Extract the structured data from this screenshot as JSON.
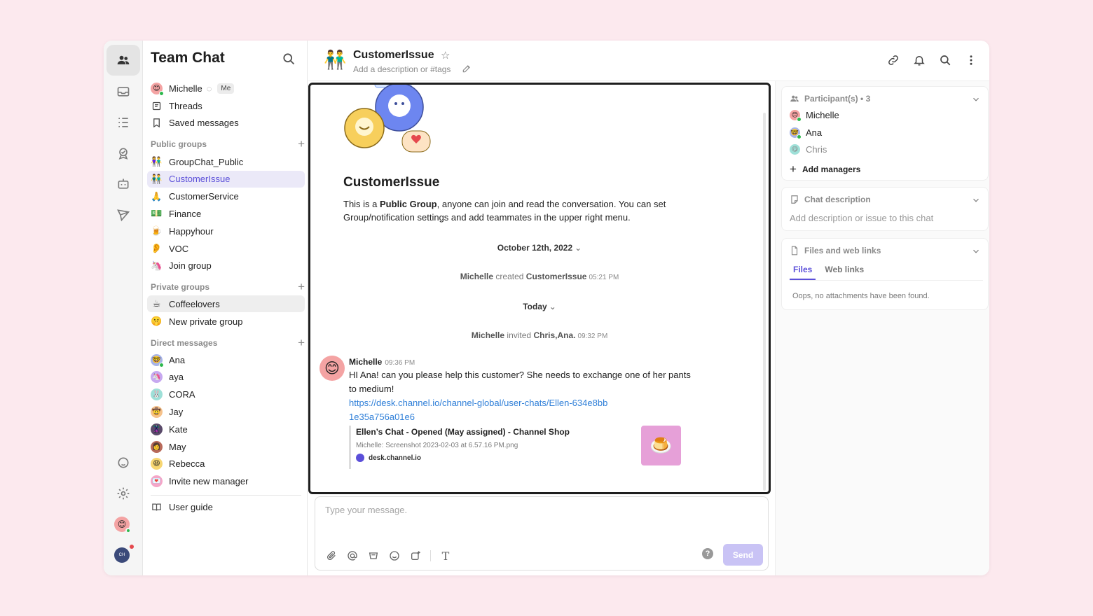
{
  "app": {
    "title": "Team Chat"
  },
  "rail": {
    "items": [
      {
        "name": "team-chat-icon",
        "active": true
      },
      {
        "name": "inbox-icon",
        "active": false
      },
      {
        "name": "list-icon",
        "active": false
      },
      {
        "name": "badge-check-icon",
        "active": false
      },
      {
        "name": "bot-icon",
        "active": false
      },
      {
        "name": "send-icon",
        "active": false
      }
    ],
    "bottom": [
      "support-icon",
      "gear-icon",
      "user-avatar",
      "workspace-avatar"
    ]
  },
  "sidebar": {
    "me": {
      "name": "Michelle",
      "badge": "Me"
    },
    "top_items": [
      {
        "label": "Threads",
        "icon": "threads-icon"
      },
      {
        "label": "Saved messages",
        "icon": "bookmark-icon"
      }
    ],
    "public_groups": {
      "title": "Public groups",
      "items": [
        {
          "label": "GroupChat_Public",
          "emoji": "👫",
          "active": false
        },
        {
          "label": "CustomerIssue",
          "emoji": "👬",
          "active": true
        },
        {
          "label": "CustomerService",
          "emoji": "🙏",
          "active": false
        },
        {
          "label": "Finance",
          "emoji": "💵",
          "active": false
        },
        {
          "label": "Happyhour",
          "emoji": "🍺",
          "active": false
        },
        {
          "label": "VOC",
          "emoji": "👂",
          "active": false
        },
        {
          "label": "Join group",
          "emoji": "🦄",
          "active": false
        }
      ]
    },
    "private_groups": {
      "title": "Private groups",
      "items": [
        {
          "label": "Coffeelovers",
          "emoji": "☕",
          "hover": true
        },
        {
          "label": "New private group",
          "emoji": "🤫",
          "hover": false
        }
      ]
    },
    "direct_messages": {
      "title": "Direct messages",
      "items": [
        {
          "label": "Ana",
          "emoji": "🤓",
          "bg": "#a7b4e8",
          "online": true
        },
        {
          "label": "aya",
          "emoji": "🦄",
          "bg": "#c7a9f0",
          "online": false
        },
        {
          "label": "CORA",
          "emoji": "🐰",
          "bg": "#9ee0d8",
          "online": false
        },
        {
          "label": "Jay",
          "emoji": "🤠",
          "bg": "#f6c28b",
          "online": false
        },
        {
          "label": "Kate",
          "emoji": "🦹",
          "bg": "#5a4a6a",
          "online": false
        },
        {
          "label": "May",
          "emoji": "👩",
          "bg": "#b86a5a",
          "online": false
        },
        {
          "label": "Rebecca",
          "emoji": "😆",
          "bg": "#f7d672",
          "online": false
        },
        {
          "label": "Invite new manager",
          "emoji": "💌",
          "bg": "#f5a6c8",
          "online": false
        }
      ]
    },
    "user_guide": "User guide"
  },
  "header": {
    "title": "CustomerIssue",
    "description_placeholder": "Add a description or #tags"
  },
  "chat": {
    "intro_title": "CustomerIssue",
    "intro_text_1": "This is a ",
    "intro_text_bold": "Public Group",
    "intro_text_2": ", anyone can join and read the conversation. You can set Group/notification settings and add teammates in the upper right menu.",
    "date_1": "October 12th, 2022",
    "sys_1": {
      "actor": "Michelle",
      "verb": "created",
      "target": "CustomerIssue",
      "time": "05:21 PM"
    },
    "date_2": "Today",
    "sys_2": {
      "actor": "Michelle",
      "verb": "invited",
      "target": "Chris,Ana.",
      "time": "09:32 PM"
    },
    "message": {
      "author": "Michelle",
      "time": "09:36 PM",
      "text": "HI Ana! can you please help this customer? She needs to exchange one of her pants to medium!",
      "link": "https://desk.channel.io/channel-global/user-chats/Ellen-634e8bb1e35a756a01e6",
      "preview": {
        "title": "Ellen’s Chat - Opened (May assigned) - Channel Shop",
        "subtitle": "Michelle: Screenshot 2023-02-03 at 6.57.16 PM.png",
        "site": "desk.channel.io"
      }
    }
  },
  "composer": {
    "placeholder": "Type your message.",
    "send_label": "Send",
    "help": "?"
  },
  "right_panel": {
    "participants": {
      "title": "Participant(s)",
      "count": "• 3",
      "items": [
        {
          "label": "Michelle",
          "emoji": "😊",
          "bg": "#f4a3a3",
          "online": true,
          "dim": false
        },
        {
          "label": "Ana",
          "emoji": "🤓",
          "bg": "#a7b4e8",
          "online": true,
          "dim": false
        },
        {
          "label": "Chris",
          "emoji": "😋",
          "bg": "#9ee0d8",
          "online": false,
          "dim": true
        }
      ],
      "add_managers": "Add managers"
    },
    "chat_description": {
      "title": "Chat description",
      "placeholder": "Add description or issue to this chat"
    },
    "files": {
      "title": "Files and web links",
      "tabs": [
        {
          "label": "Files",
          "active": true
        },
        {
          "label": "Web links",
          "active": false
        }
      ],
      "empty": "Oops, no attachments have been found."
    }
  },
  "colors": {
    "accent": "#5b4fd9",
    "link": "#2f7fd8",
    "background": "#fce9ee",
    "online": "#2db84d"
  }
}
